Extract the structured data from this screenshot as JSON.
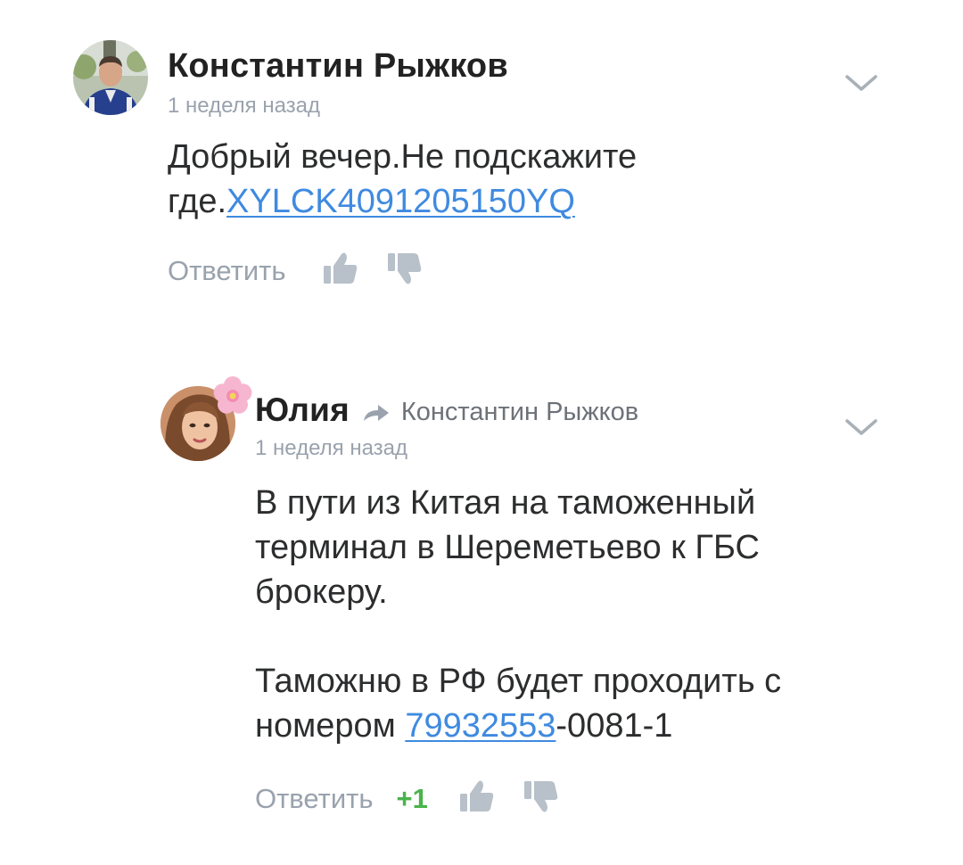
{
  "comments": [
    {
      "author": "Константин Рыжков",
      "time": "1 неделя назад",
      "text_prefix": "Добрый вечер.Не подскажите где.",
      "link_text": "XYLCK4091205150YQ",
      "reply_label": "Ответить"
    },
    {
      "author": "Юлия",
      "reply_to": "Константин Рыжков",
      "time": "1 неделя назад",
      "paragraph1": "В пути из Китая на таможенный терминал в Шереметьево к ГБС брокеру.",
      "paragraph2_prefix": "Таможню в РФ будет проходить с номером ",
      "paragraph2_link": "79932553",
      "paragraph2_suffix": "-0081-1",
      "reply_label": "Ответить",
      "likes": "+1"
    }
  ],
  "icons": {
    "like": "thumb-up-icon",
    "dislike": "thumb-down-icon",
    "menu": "chevron-down-icon",
    "reply_arrow": "reply-arrow-icon",
    "decoration": "flower-sticker-icon"
  },
  "colors": {
    "link": "#3f8ae0",
    "muted": "#99a2ad",
    "text": "#2c2d2e",
    "likes_positive": "#4bb34b"
  }
}
